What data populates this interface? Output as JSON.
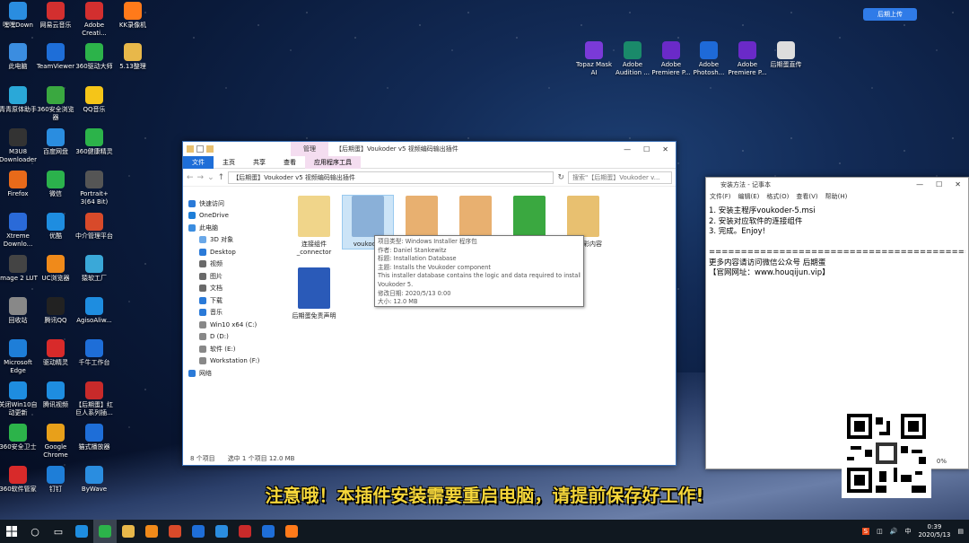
{
  "desktop_icons": [
    {
      "label": "嘿嘿Down",
      "color": "#2a8de0"
    },
    {
      "label": "网易云音乐",
      "color": "#d32f2f"
    },
    {
      "label": "Adobe Creati...",
      "color": "#d32f2f"
    },
    {
      "label": "KK录像机",
      "color": "#ff7a1a"
    },
    {
      "label": "此电脑",
      "color": "#3b8de0"
    },
    {
      "label": "TeamViewer",
      "color": "#1e6ed8"
    },
    {
      "label": "360驱动大师",
      "color": "#2cb34a"
    },
    {
      "label": "5.13整理",
      "color": "#e8b84a"
    },
    {
      "label": "青青原体助手",
      "color": "#2aa8d8"
    },
    {
      "label": "360安全浏览器",
      "color": "#3aa840"
    },
    {
      "label": "QQ音乐",
      "color": "#f5c518"
    },
    {
      "label": "M3U8 Downloader",
      "color": "#333"
    },
    {
      "label": "百度网盘",
      "color": "#2a8de0"
    },
    {
      "label": "360健康精灵",
      "color": "#2cb34a"
    },
    {
      "label": "Firefox",
      "color": "#e86a1a"
    },
    {
      "label": "微信",
      "color": "#2bb24c"
    },
    {
      "label": "Portrait+ 3(64 Bit)",
      "color": "#555"
    },
    {
      "label": "Xtreme Downlo...",
      "color": "#2a6ad8"
    },
    {
      "label": "优酷",
      "color": "#1e8de0"
    },
    {
      "label": "中介管理平台",
      "color": "#d84a2a"
    },
    {
      "label": "Image 2 LUT",
      "color": "#444"
    },
    {
      "label": "UC浏览器",
      "color": "#f08a1a"
    },
    {
      "label": "猿软工厂",
      "color": "#3aa8d8"
    },
    {
      "label": "回收站",
      "color": "#888"
    },
    {
      "label": "腾讯QQ",
      "color": "#222"
    },
    {
      "label": "AgisoAliw...",
      "color": "#1e8de0"
    },
    {
      "label": "Microsoft Edge",
      "color": "#1e7ed8"
    },
    {
      "label": "驱动精灵",
      "color": "#d82a2a"
    },
    {
      "label": "千牛工作台",
      "color": "#1e6ed8"
    },
    {
      "label": "关闭Win10自动更新",
      "color": "#1e8de0"
    },
    {
      "label": "腾讯视频",
      "color": "#1e8de0"
    },
    {
      "label": "【后期蛋】红巨人系列插...",
      "color": "#c82a2a"
    },
    {
      "label": "360安全卫士",
      "color": "#2cb34a"
    },
    {
      "label": "Google Chrome",
      "color": "#e8a01a"
    },
    {
      "label": "猫式播放器",
      "color": "#1e6ed8"
    },
    {
      "label": "360软件管家",
      "color": "#d82a2a"
    },
    {
      "label": "钉钉",
      "color": "#1e7ed8"
    },
    {
      "label": "ByWave",
      "color": "#2a8de0"
    },
    {
      "label": "Topaz Mask AI",
      "color": "#7a3ad8"
    },
    {
      "label": "Adobe Audition ...",
      "color": "#1a8a6a"
    },
    {
      "label": "Adobe Premiere P...",
      "color": "#6a2ac8"
    },
    {
      "label": "Adobe Photosh...",
      "color": "#1e6ad8"
    },
    {
      "label": "Adobe Premiere P...",
      "color": "#6a2ac8"
    },
    {
      "label": "后期蛋直传",
      "color": "#ddd"
    }
  ],
  "upload_button": "后期上传",
  "explorer": {
    "title": "【后期蛋】Voukoder v5 视频编码输出插件",
    "manage_tab": "管理",
    "app_tools_tab": "应用程序工具",
    "tabs": [
      "文件",
      "主页",
      "共享",
      "查看"
    ],
    "address": "【后期蛋】Voukoder v5 视频编码输出插件",
    "search_placeholder": "搜索\"【后期蛋】Voukoder v...",
    "nav": [
      {
        "label": "快速访问",
        "color": "#2a7ad8",
        "indent": 0
      },
      {
        "label": "OneDrive",
        "color": "#1e7ed8",
        "indent": 0
      },
      {
        "label": "此电脑",
        "color": "#3b8de0",
        "indent": 0
      },
      {
        "label": "3D 对象",
        "color": "#6aa8e8",
        "indent": 1
      },
      {
        "label": "Desktop",
        "color": "#2a7ad8",
        "indent": 1
      },
      {
        "label": "视频",
        "color": "#6a6a6a",
        "indent": 1
      },
      {
        "label": "图片",
        "color": "#6a6a6a",
        "indent": 1
      },
      {
        "label": "文档",
        "color": "#6a6a6a",
        "indent": 1
      },
      {
        "label": "下载",
        "color": "#2a7ad8",
        "indent": 1
      },
      {
        "label": "音乐",
        "color": "#2a7ad8",
        "indent": 1
      },
      {
        "label": "Win10 x64 (C:)",
        "color": "#888",
        "indent": 1
      },
      {
        "label": "D (D:)",
        "color": "#888",
        "indent": 1
      },
      {
        "label": "软件 (E:)",
        "color": "#888",
        "indent": 1
      },
      {
        "label": "Workstation (F:)",
        "color": "#888",
        "indent": 1
      },
      {
        "label": "网络",
        "color": "#2a7ad8",
        "indent": 0
      }
    ],
    "files": [
      {
        "label": "连接组件_connector",
        "color": "#f0d58a"
      },
      {
        "label": "voukoder",
        "color": "#8ab0d8"
      },
      {
        "label": "",
        "color": "#e8b070"
      },
      {
        "label": "",
        "color": "#e8b070"
      },
      {
        "label": "免费精品内容设置!",
        "color": "#3aa840"
      },
      {
        "label": "更过精彩内容",
        "color": "#e8c070"
      },
      {
        "label": "后期蛋免责声明",
        "color": "#2a5ab8"
      }
    ],
    "status_count": "8 个项目",
    "status_selected": "选中 1 个项目  12.0 MB",
    "tooltip": [
      "项目类型: Windows Installer 程序包",
      "作者: Daniel Stankewitz",
      "标题: Installation Database",
      "主题: Installs the Voukoder component",
      "This installer database contains the logic and data required to install",
      "Voukoder 5.",
      "修改日期: 2020/5/13 0:00",
      "大小: 12.0 MB"
    ]
  },
  "notepad": {
    "title": "安装方法 - 记事本",
    "menu": [
      "文件(F)",
      "编辑(E)",
      "格式(O)",
      "查看(V)",
      "帮助(H)"
    ],
    "lines": [
      "1. 安装主程序voukoder-5.msi",
      "2. 安装对应软件的连接组件",
      "3. 完成。Enjoy!",
      "",
      "==============================================",
      "更多内容请访问微信公众号 后期蛋",
      "【官网网址：www.houqijun.vip】"
    ],
    "zoom": "0%"
  },
  "subtitle": "注意哦！本插件安装需要重启电脑，请提前保存好工作!",
  "taskbar": {
    "apps": [
      "#1e8de0",
      "#2cb34a",
      "#e8b84a",
      "#f08a1a",
      "#d84a2a",
      "#1e6ed8",
      "#2a8de0",
      "#c82a2a",
      "#1e6ed8",
      "#ff7a1a"
    ],
    "ime": "中",
    "time": "0:39",
    "date": "2020/5/13"
  }
}
